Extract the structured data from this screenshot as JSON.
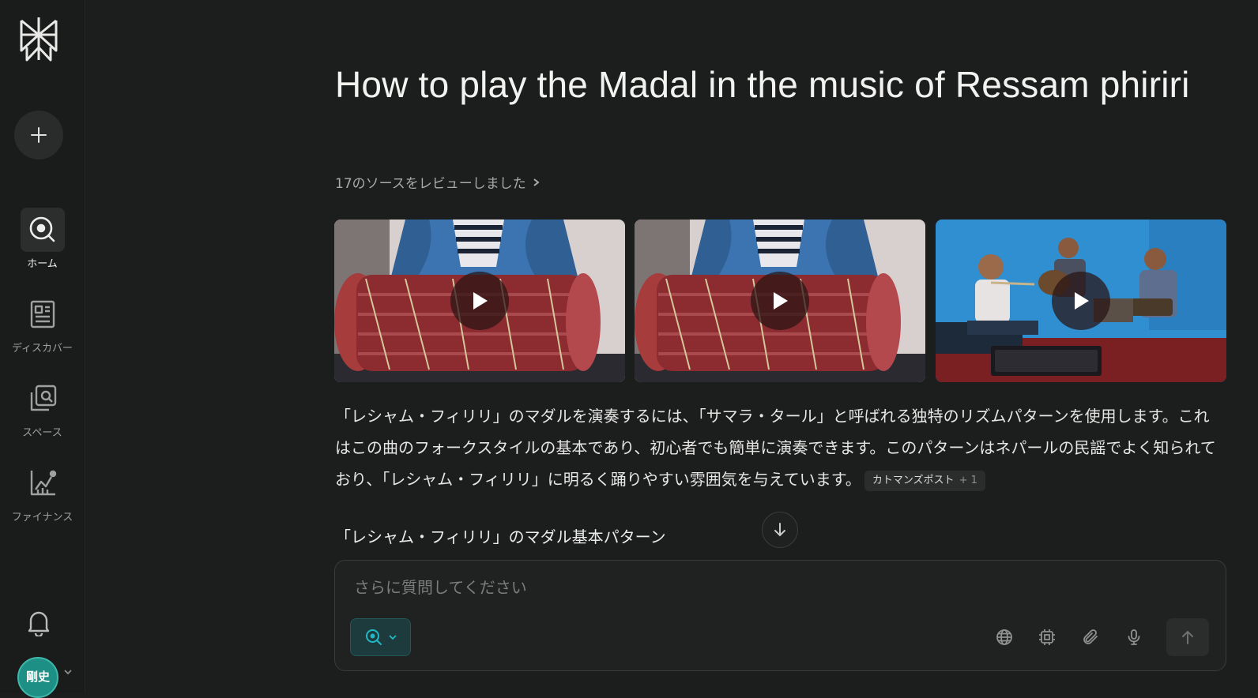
{
  "sidebar": {
    "new_thread_label": "+",
    "nav": [
      {
        "label": "ホーム",
        "icon": "search-icon",
        "active": true
      },
      {
        "label": "ディスカバー",
        "icon": "newspaper-icon",
        "active": false
      },
      {
        "label": "スペース",
        "icon": "spaces-icon",
        "active": false
      },
      {
        "label": "ファイナンス",
        "icon": "chart-icon",
        "active": false
      }
    ],
    "avatar_text": "剛史"
  },
  "main": {
    "title": "How to play the Madal in the music of Ressam phiriri",
    "sources_label": "17のソースをレビューしました",
    "videos": [
      {
        "icon": "play-icon"
      },
      {
        "icon": "play-icon"
      },
      {
        "icon": "play-icon"
      }
    ],
    "answer_text": "「レシャム・フィリリ」のマダルを演奏するには、「サマラ・タール」と呼ばれる独特のリズムパターンを使用します。これはこの曲のフォークスタイルの基本であり、初心者でも簡単に演奏できます。このパターンはネパールの民謡でよく知られており、「レシャム・フィリリ」に明るく踊りやすい雰囲気を与えています。",
    "citation": {
      "label": "カトマンズポスト",
      "more": "+ 1"
    },
    "section_heading": "「レシャム・フィリリ」のマダル基本パターン"
  },
  "composer": {
    "placeholder": "さらに質問してください",
    "tools": [
      "globe-icon",
      "chip-icon",
      "paperclip-icon",
      "microphone-icon"
    ]
  },
  "colors": {
    "background": "#1c1d1d",
    "sidebar": "#1a1b1b",
    "accent_teal": "#20b8c4",
    "avatar": "#1e8f84"
  }
}
